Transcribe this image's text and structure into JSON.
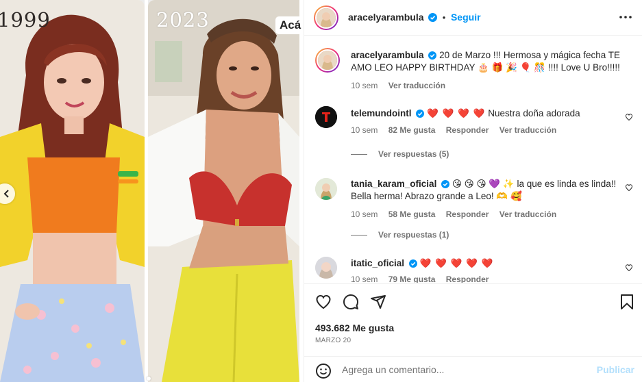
{
  "media": {
    "year_left": "1999",
    "year_right": "2023",
    "chip_text": "Acá",
    "nav_prev_icon": "chevron-left-icon"
  },
  "post": {
    "username": "aracelyarambula",
    "follow_label": "Seguir",
    "more_icon": "more-horizontal-icon"
  },
  "caption": {
    "username": "aracelyarambula",
    "text": "20 de Marzo !!! Hermosa y mágica fecha TE AMO LEO HAPPY BIRTHDAY 🎂 🎁 🎉 🎈 🎊  !!!! Love U Bro!!!!!",
    "time": "10 sem",
    "translate": "Ver traducción"
  },
  "comments": [
    {
      "username": "telemundointl",
      "hearts": "❤️ ❤️ ❤️ ❤️",
      "text": "Nuestra doña adorada",
      "time": "10 sem",
      "likes": "82 Me gusta",
      "reply": "Responder",
      "translate": "Ver traducción",
      "view_replies": "Ver respuestas (5)"
    },
    {
      "username": "tania_karam_oficial",
      "text": "😘 😘 😘 💜 ✨  la que es linda es linda!! Bella herma! Abrazo grande a Leo! 🫶 🥰",
      "time": "10 sem",
      "likes": "58 Me gusta",
      "reply": "Responder",
      "translate": "Ver traducción",
      "view_replies": "Ver respuestas (1)"
    },
    {
      "username": "itatic_oficial",
      "hearts": "❤️ ❤️ ❤️ ❤️ ❤️",
      "time": "10 sem",
      "likes": "79 Me gusta",
      "reply": "Responder"
    }
  ],
  "actions": {
    "likes": "493.682 Me gusta",
    "date": "MARZO 20"
  },
  "add_comment": {
    "placeholder": "Agrega un comentario...",
    "publish": "Publicar"
  },
  "colors": {
    "accent": "#0095f6",
    "publish_disabled": "#b2dffc",
    "muted": "#737373",
    "heart": "#ed1c24"
  }
}
